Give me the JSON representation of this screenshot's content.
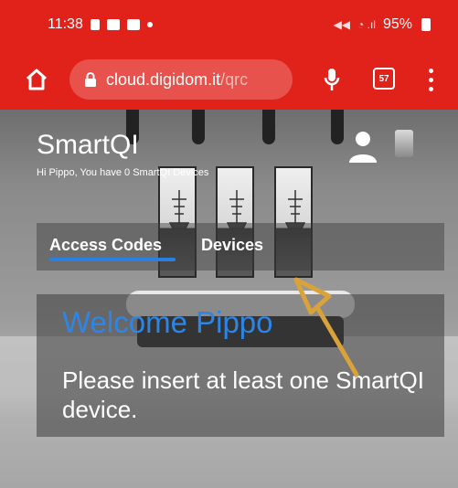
{
  "status_bar": {
    "time": "11:38",
    "battery_percent": "95%"
  },
  "browser": {
    "url_domain": "cloud.digidom.it",
    "url_path": "/qrc",
    "tab_count": "57",
    "icons": [
      "home-icon",
      "lock-icon",
      "mic-icon",
      "tabs-icon",
      "menu-icon"
    ]
  },
  "app": {
    "title": "SmartQI",
    "subtitle": "Hi Pippo, You have 0 SmartQI Devices",
    "tabs": [
      {
        "label": "Access Codes",
        "active": true
      },
      {
        "label": "Devices",
        "active": false
      }
    ],
    "welcome": "Welcome Pippo",
    "message": "Please insert at least one SmartQI device."
  },
  "colors": {
    "browser_red": "#e0221b",
    "accent_blue": "#2d86e6",
    "annotation_arrow": "#d9a23a"
  }
}
